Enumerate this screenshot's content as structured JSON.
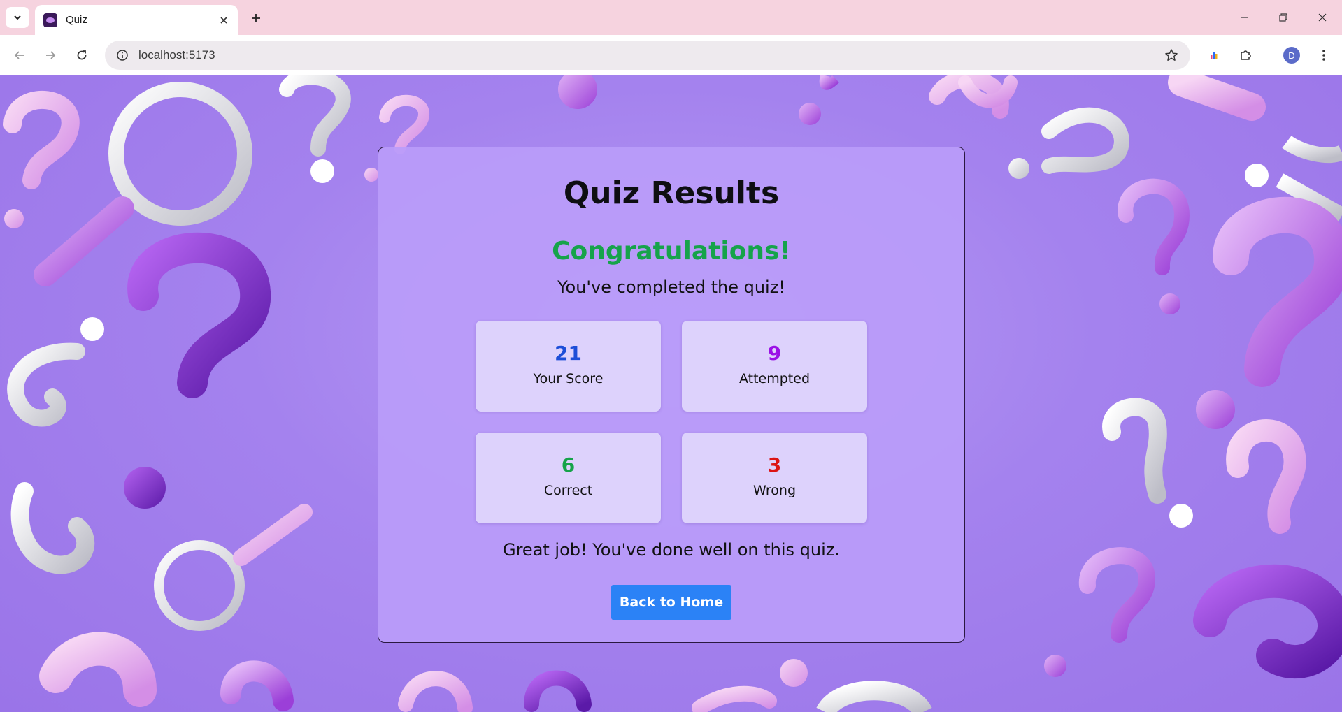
{
  "browser": {
    "tab_title": "Quiz",
    "url": "localhost:5173",
    "profile_initial": "D",
    "icons": {
      "tab_search": "chevron-down-icon",
      "close": "close-icon",
      "new_tab": "plus-icon",
      "back": "arrow-left-icon",
      "forward": "arrow-right-icon",
      "reload": "reload-icon",
      "site_info": "info-icon",
      "bookmark": "star-icon",
      "extensions": "puzzle-icon",
      "menu": "more-vert-icon"
    }
  },
  "page": {
    "title": "Quiz Results",
    "congrats": "Congratulations!",
    "subtitle": "You've completed the quiz!",
    "stats": {
      "score": {
        "value": "21",
        "label": "Your Score",
        "color": "#1d4ed8"
      },
      "attempted": {
        "value": "9",
        "label": "Attempted",
        "color": "#9b11e6"
      },
      "correct": {
        "value": "6",
        "label": "Correct",
        "color": "#16a34a"
      },
      "wrong": {
        "value": "3",
        "label": "Wrong",
        "color": "#dc1414"
      }
    },
    "message": "Great job! You've done well on this quiz.",
    "button_label": "Back to Home"
  },
  "colors": {
    "background": "#a482ee",
    "card": "#ba9cfa",
    "accent_button": "#2b82f6",
    "congrats": "#16a34a"
  }
}
